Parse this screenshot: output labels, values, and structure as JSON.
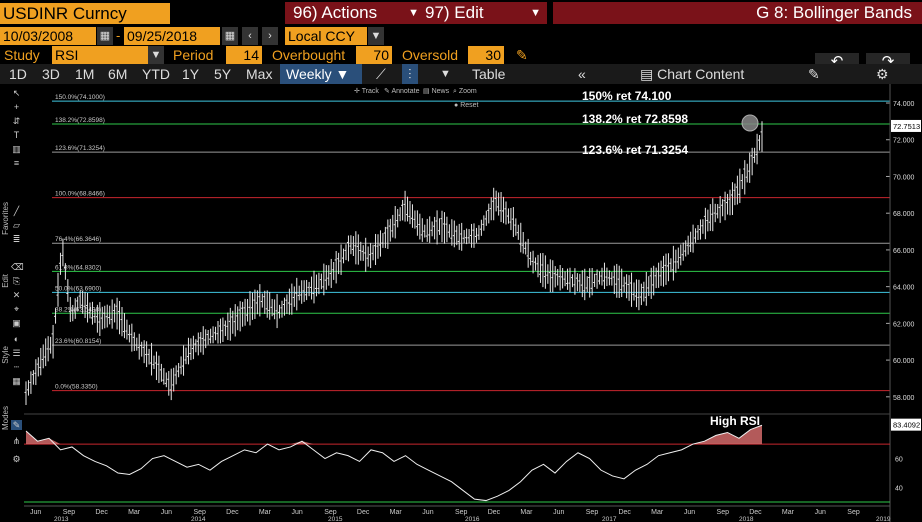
{
  "header": {
    "ticker": "USDINR Curncy",
    "actions": "96) Actions",
    "edit": "97) Edit",
    "chart_title": "G 8: Bollinger Bands"
  },
  "dates": {
    "start": "10/03/2008",
    "dash": "-",
    "end": "09/25/2018",
    "currency": "Local CCY"
  },
  "study": {
    "label": "Study",
    "value": "RSI",
    "period_label": "Period",
    "period": "14",
    "overbought_label": "Overbought",
    "overbought": "70",
    "oversold_label": "Oversold",
    "oversold": "30"
  },
  "toolbar": {
    "ranges": [
      "1D",
      "3D",
      "1M",
      "6M",
      "YTD",
      "1Y",
      "5Y",
      "Max"
    ],
    "period": "Weekly",
    "table": "Table",
    "chart_content": "Chart Content"
  },
  "mini_menu": {
    "track": "Track",
    "annotate": "Annotate",
    "news": "News",
    "zoom": "Zoom",
    "reset": "Reset"
  },
  "side_labels": {
    "favorites": "Favorites",
    "edit": "Edit",
    "style": "Style",
    "modes": "Modes"
  },
  "annotations": {
    "r150": "150% ret 74.100",
    "r138": "138.2% ret 72.8598",
    "r123": "123.6% ret 71.3254",
    "high_rsi": "High RSI"
  },
  "fib_levels": [
    {
      "label": "150.0%(74.1000)",
      "value": 74.1,
      "color": "#3fc6e0"
    },
    {
      "label": "138.2%(72.8598)",
      "value": 72.8598,
      "color": "#2ec84a"
    },
    {
      "label": "123.6%(71.3254)",
      "value": 71.3254,
      "color": "#9a9a9a"
    },
    {
      "label": "100.0%(68.8466)",
      "value": 68.8466,
      "color": "#c8262e"
    },
    {
      "label": "76.4%(66.3646)",
      "value": 66.3646,
      "color": "#9a9a9a"
    },
    {
      "label": "61.8%(64.8302)",
      "value": 64.8302,
      "color": "#2ec84a"
    },
    {
      "label": "50.0%(63.6900)",
      "value": 63.69,
      "color": "#3fc6e0"
    },
    {
      "label": "38.2%(62.5498)",
      "value": 62.5498,
      "color": "#2ec84a"
    },
    {
      "label": "23.6%(60.8154)",
      "value": 60.8154,
      "color": "#9a9a9a"
    },
    {
      "label": "0.0%(58.3350)",
      "value": 58.335,
      "color": "#c8262e"
    }
  ],
  "chart_data": [
    {
      "type": "line",
      "title": "",
      "ylim": [
        57.5,
        74.6
      ],
      "y_ticks": [
        58,
        60,
        62,
        64,
        66,
        68,
        70,
        72,
        74
      ],
      "y_tick_labels": [
        "58.000",
        "60.000",
        "62.000",
        "64.000",
        "66.000",
        "68.000",
        "70.000",
        "72.000",
        "74.000"
      ],
      "last_value": 72.7513,
      "last_value_label": "72.7513",
      "x_month_labels": [
        "Jun",
        "Sep",
        "Dec",
        "Mar",
        "Jun",
        "Sep",
        "Dec",
        "Mar",
        "Jun",
        "Sep",
        "Dec",
        "Mar",
        "Jun",
        "Sep",
        "Dec",
        "Mar",
        "Jun",
        "Sep",
        "Dec",
        "Mar",
        "Jun",
        "Sep",
        "Dec",
        "Mar",
        "Jun",
        "Sep"
      ],
      "x_year_labels": [
        "2013",
        "2014",
        "2015",
        "2016",
        "2017",
        "2018",
        "2019"
      ],
      "series": [
        {
          "x_fraction": [
            0,
            0.02,
            0.03,
            0.04,
            0.05,
            0.06,
            0.08,
            0.1,
            0.12,
            0.14,
            0.16,
            0.18,
            0.2,
            0.22,
            0.24,
            0.26,
            0.28,
            0.3,
            0.32,
            0.34,
            0.36,
            0.38,
            0.4,
            0.42,
            0.44,
            0.46,
            0.48,
            0.5,
            0.52,
            0.54,
            0.56,
            0.58,
            0.6,
            0.62,
            0.64,
            0.66,
            0.68,
            0.7,
            0.72,
            0.74,
            0.76,
            0.78,
            0.8,
            0.82,
            0.84,
            0.86,
            0.88,
            0.9,
            0.92
          ],
          "values": [
            58.2,
            60.3,
            61.0,
            66.2,
            62.4,
            63.3,
            62.2,
            62.6,
            61.0,
            60.0,
            58.6,
            60.5,
            61.2,
            61.7,
            62.5,
            63.3,
            62.6,
            63.6,
            64.0,
            64.8,
            66.3,
            65.6,
            66.8,
            68.4,
            67.0,
            67.3,
            66.7,
            66.8,
            68.7,
            67.5,
            65.4,
            64.6,
            64.4,
            64.1,
            64.6,
            64.2,
            63.5,
            64.6,
            65.4,
            66.7,
            67.9,
            68.6,
            70.3,
            72.8,
            72.9,
            72.9,
            72.9,
            72.9,
            72.9
          ]
        }
      ]
    },
    {
      "type": "line",
      "title": "RSI",
      "ylim": [
        30,
        88
      ],
      "y_ticks": [
        40,
        60
      ],
      "y_tick_labels": [
        "40",
        "60"
      ],
      "overbought": 70,
      "oversold": 30,
      "last_value": 83.4092,
      "last_value_label": "83.4092",
      "series": [
        {
          "values": [
            79,
            72,
            74,
            66,
            68,
            62,
            58,
            55,
            50,
            49,
            53,
            60,
            62,
            58,
            54,
            56,
            52,
            58,
            62,
            66,
            64,
            70,
            66,
            68,
            72,
            66,
            60,
            64,
            62,
            58,
            66,
            64,
            58,
            62,
            56,
            52,
            48,
            44,
            38,
            32,
            31,
            34,
            38,
            44,
            52,
            56,
            50,
            58,
            64,
            60,
            52,
            48,
            46,
            52,
            56,
            62,
            64,
            66,
            70,
            72,
            76,
            78,
            74,
            80,
            83
          ]
        }
      ]
    }
  ]
}
